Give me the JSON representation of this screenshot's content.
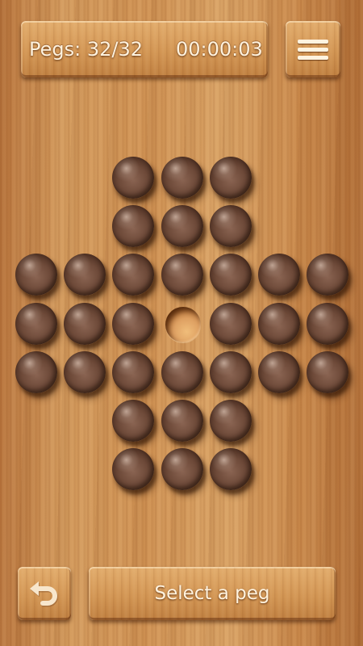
{
  "hud": {
    "pegs_label": "Pegs:",
    "pegs_count": "32/32",
    "timer": "00:00:03"
  },
  "status": {
    "message": "Select a peg"
  },
  "icons": {
    "menu": "hamburger-menu-icon",
    "undo": "undo-arrow-icon"
  },
  "colors": {
    "board_wood": "#d29553",
    "peg": "#6e4a39",
    "hud_text": "#fff3df"
  },
  "board": {
    "type": "english-cross",
    "rows": [
      [
        null,
        null,
        1,
        1,
        1,
        null,
        null
      ],
      [
        null,
        null,
        1,
        1,
        1,
        null,
        null
      ],
      [
        1,
        1,
        1,
        1,
        1,
        1,
        1
      ],
      [
        1,
        1,
        1,
        0,
        1,
        1,
        1
      ],
      [
        1,
        1,
        1,
        1,
        1,
        1,
        1
      ],
      [
        null,
        null,
        1,
        1,
        1,
        null,
        null
      ],
      [
        null,
        null,
        1,
        1,
        1,
        null,
        null
      ]
    ]
  }
}
